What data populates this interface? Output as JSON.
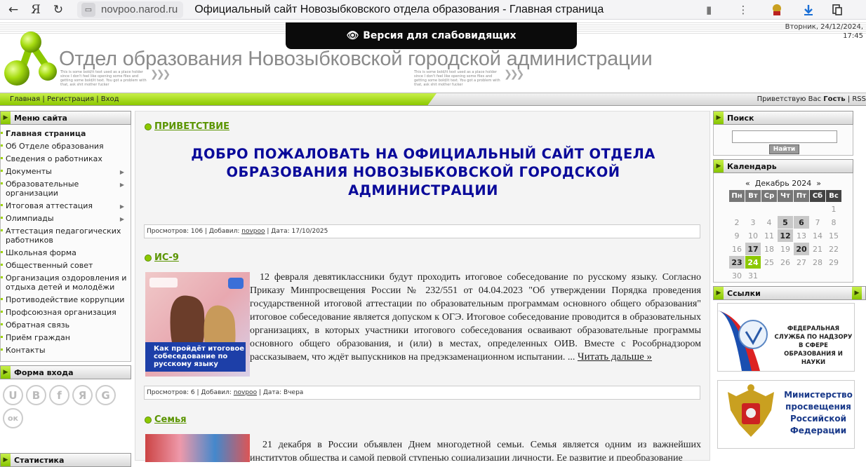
{
  "browser": {
    "url": "novpoo.narod.ru",
    "title": "Официальный сайт Новозыбковского отдела образования - Главная страница"
  },
  "header": {
    "vision_label": "Версия для слабовидящих",
    "date_line1": "Вторник, 24/12/2024,",
    "date_line2": "17:45",
    "site_name": "Отдел образования Новозыбковской городской администрации",
    "placeholder_text": "This is some bold/it text used as a place holder since I don't feel like opening some files and getting some bold/it text. You got a problem with that, ask shit mother fucker"
  },
  "nav": {
    "home": "Главная",
    "register": "Регистрация",
    "login": "Вход",
    "sep": "|",
    "greet_prefix": "Приветствую Вас",
    "greet_user": "Гость",
    "rss": "RSS"
  },
  "left": {
    "menu_title": "Меню сайта",
    "menu": [
      {
        "label": "Главная страница",
        "active": true,
        "sub": false
      },
      {
        "label": "Об Отделе образования",
        "sub": false
      },
      {
        "label": "Сведения о работниках",
        "sub": false
      },
      {
        "label": "Документы",
        "sub": true
      },
      {
        "label": "Образовательные организации",
        "sub": true
      },
      {
        "label": "Итоговая аттестация",
        "sub": true
      },
      {
        "label": "Олимпиады",
        "sub": true
      },
      {
        "label": "Аттестация педагогических работников",
        "sub": false
      },
      {
        "label": "Школьная форма",
        "sub": false
      },
      {
        "label": "Общественный совет",
        "sub": false
      },
      {
        "label": "Организация оздоровления и отдыха детей и молодёжи",
        "sub": false
      },
      {
        "label": "Противодействие коррупции",
        "sub": false
      },
      {
        "label": "Профсоюзная организация",
        "sub": false
      },
      {
        "label": "Обратная связь",
        "sub": false
      },
      {
        "label": "Приём граждан",
        "sub": false
      },
      {
        "label": "Контакты",
        "sub": false
      }
    ],
    "login_title": "Форма входа",
    "socials": [
      "U",
      "B",
      "f",
      "Я",
      "G",
      "ок"
    ],
    "stats_title": "Статистика"
  },
  "main": {
    "greeting_title": "ПРИВЕТСТВИЕ",
    "welcome_text": "ДОБРО ПОЖАЛОВАТЬ НА ОФИЦИАЛЬНЫЙ САЙТ ОТДЕЛА ОБРАЗОВАНИЯ НОВОЗЫБКОВСКОЙ ГОРОДСКОЙ АДМИНИСТРАЦИИ",
    "meta1": {
      "views": "Просмотров: 106",
      "added": "Добавил:",
      "author": "novpoo",
      "date": "Дата: 17/10/2025"
    },
    "article1": {
      "title": "ИС-9",
      "text": "12 февраля девятиклассники будут проходить итоговое собеседование по русскому языку. Согласно Приказу Минпросвещения России № 232/551 от 04.04.2023 \"Об утверждении Порядка проведения государственной итоговой аттестации по образовательным программам основного общего образования\" итоговое собеседование является допуском к ОГЭ. Итоговое собеседование проводится в образовательных организациях, в которых участники итогового собеседования осваивают образовательные программы основного общего образования, и (или) в местах, определенных ОИВ. Вместе с Рособрнадзором рассказываем, что ждёт выпускников на предэкзаменационном испытании. ...",
      "more": "Читать дальше »",
      "thumb_caption": "Как пройдёт итоговое собеседование по русскому языку"
    },
    "meta2": {
      "views": "Просмотров: 6",
      "added": "Добавил:",
      "author": "novpoo",
      "date": "Дата: Вчера"
    },
    "article2": {
      "title": "Семья",
      "text": "21 декабря в России объявлен Днем многодетной семьи. Семья является одним из важнейших институтов общества и самой первой ступенью социализации личности. Ее развитие и преобразование"
    }
  },
  "right": {
    "search_title": "Поиск",
    "search_button": "Найти",
    "calendar_title": "Календарь",
    "cal_month": "Декабрь 2024",
    "cal_prev": "«",
    "cal_next": "»",
    "cal_days": [
      "Пн",
      "Вт",
      "Ср",
      "Чт",
      "Пт",
      "Сб",
      "Вс"
    ],
    "cal_weeks": [
      [
        "",
        "",
        "",
        "",
        "",
        "",
        "1"
      ],
      [
        "2",
        "3",
        "4",
        "5",
        "6",
        "7",
        "8"
      ],
      [
        "9",
        "10",
        "11",
        "12",
        "13",
        "14",
        "15"
      ],
      [
        "16",
        "17",
        "18",
        "19",
        "20",
        "21",
        "22"
      ],
      [
        "23",
        "24",
        "25",
        "26",
        "27",
        "28",
        "29"
      ],
      [
        "30",
        "31",
        "",
        "",
        "",
        "",
        ""
      ]
    ],
    "cal_events": [
      "5",
      "6",
      "12",
      "17",
      "20",
      "23"
    ],
    "cal_today": "24",
    "links_title": "Ссылки",
    "banner1": "ФЕДЕРАЛЬНАЯ СЛУЖБА ПО НАДЗОРУ В СФЕРЕ ОБРАЗОВАНИЯ И НАУКИ",
    "banner2": "Министерство просвещения Российской Федерации"
  }
}
